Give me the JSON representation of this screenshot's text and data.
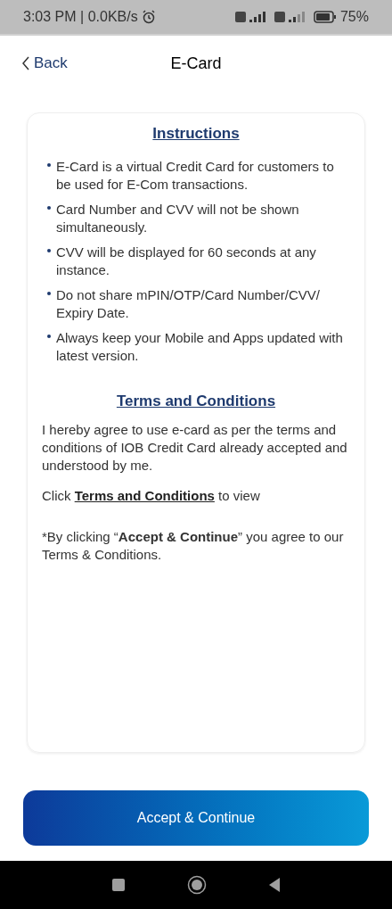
{
  "status_bar": {
    "time": "3:03 PM | 0.0KB/s",
    "battery": "75%"
  },
  "header": {
    "back": "Back",
    "title": "E-Card"
  },
  "instructions": {
    "title": "Instructions",
    "items": [
      "E-Card is a virtual Credit Card for customers to be used for E-Com transactions.",
      "Card Number and CVV will not be shown simultaneously.",
      "CVV will be displayed for 60 seconds at any instance.",
      "Do not share mPIN/OTP/Card Number/CVV/ Expiry Date.",
      "Always keep your Mobile and Apps updated with latest version."
    ]
  },
  "terms": {
    "title": "Terms and Conditions",
    "agreement": "I hereby agree to use e-card as per the terms and conditions of IOB Credit Card already accepted and understood by me.",
    "click_prefix": "Click",
    "link": "Terms and Conditions",
    "click_suffix": "to view",
    "disclaimer": "*By clicking “**Accept & Continue**” you agree to our Terms & Conditions."
  },
  "button": "Accept & Continue"
}
